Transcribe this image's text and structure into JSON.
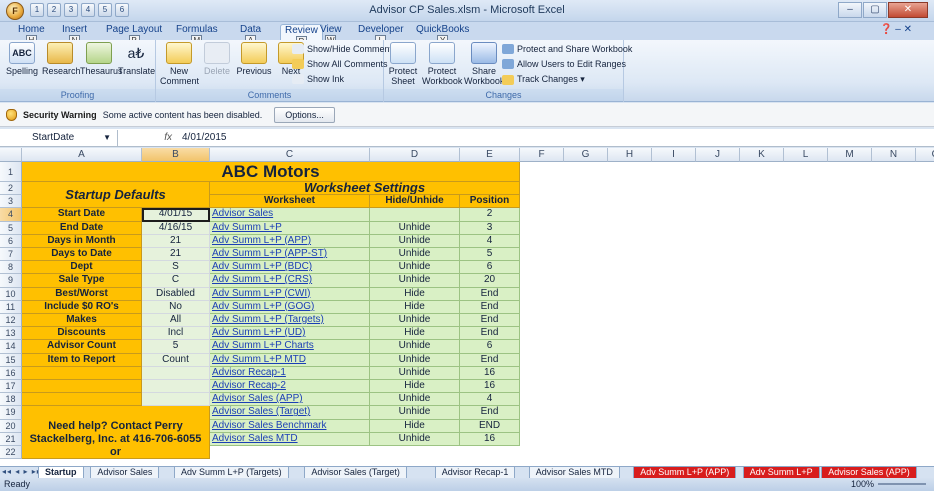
{
  "window": {
    "title": "Advisor CP Sales.xlsm - Microsoft Excel",
    "office_button": "F",
    "qat": [
      "1",
      "2",
      "3",
      "4",
      "5",
      "6"
    ],
    "controls": [
      "–",
      "▢",
      "✕"
    ]
  },
  "tabs": [
    {
      "label": "Home",
      "key": "H"
    },
    {
      "label": "Insert",
      "key": "N"
    },
    {
      "label": "Page Layout",
      "key": "P"
    },
    {
      "label": "Formulas",
      "key": "M"
    },
    {
      "label": "Data",
      "key": "A"
    },
    {
      "label": "Review",
      "key": "R"
    },
    {
      "label": "View",
      "key": "W"
    },
    {
      "label": "Developer",
      "key": "L"
    },
    {
      "label": "QuickBooks",
      "key": "Y"
    }
  ],
  "ribbon": {
    "proofing": {
      "label": "Proofing",
      "buttons": [
        "Spelling",
        "Research",
        "Thesaurus",
        "Translate"
      ]
    },
    "comments": {
      "label": "Comments",
      "new": "New Comment",
      "delete": "Delete",
      "previous": "Previous",
      "next": "Next",
      "show_hide": "Show/Hide Comment",
      "show_all": "Show All Comments",
      "show_ink": "Show Ink"
    },
    "changes": {
      "label": "Changes",
      "protect_sheet": "Protect Sheet",
      "protect_workbook": "Protect Workbook",
      "share_workbook": "Share Workbook",
      "protect_share": "Protect and Share Workbook",
      "allow_users": "Allow Users to Edit Ranges",
      "track_changes": "Track Changes ▾"
    }
  },
  "security": {
    "title": "Security Warning",
    "message": "Some active content has been disabled.",
    "options": "Options..."
  },
  "formula_bar": {
    "name_box": "StartDate",
    "fx": "fx",
    "value": "4/01/2015"
  },
  "columns": [
    "A",
    "B",
    "C",
    "D",
    "E",
    "F",
    "G",
    "H",
    "I",
    "J",
    "K",
    "L",
    "M",
    "N",
    "O"
  ],
  "sheet": {
    "title": "ABC Motors",
    "startup_header": "Startup Defaults",
    "worksheet_header": "Worksheet Settings",
    "col_headers": [
      "Worksheet",
      "Hide/Unhide",
      "Position"
    ],
    "defaults": [
      [
        "Start Date",
        "4/01/15"
      ],
      [
        "End Date",
        "4/16/15"
      ],
      [
        "Days in Month",
        "21"
      ],
      [
        "Days to Date",
        "21"
      ],
      [
        "Dept",
        "S"
      ],
      [
        "Sale Type",
        "C"
      ],
      [
        "Best/Worst",
        "Disabled"
      ],
      [
        "Include $0 RO's",
        "No"
      ],
      [
        "Makes",
        "All"
      ],
      [
        "Discounts",
        "Incl"
      ],
      [
        "Advisor Count",
        "5"
      ],
      [
        "Item to Report",
        "Count"
      ]
    ],
    "help_text": "Need help? Contact Perry Stackelberg, Inc. at 416-706-6055 or",
    "worksheets": [
      [
        "Advisor Sales",
        "",
        "2"
      ],
      [
        "Adv Summ L+P",
        "Unhide",
        "3"
      ],
      [
        "Adv Summ L+P (APP)",
        "Unhide",
        "4"
      ],
      [
        "Adv Summ L+P (APP-ST)",
        "Unhide",
        "5"
      ],
      [
        "Adv Summ L+P (BDC)",
        "Unhide",
        "6"
      ],
      [
        "Adv Summ L+P (CRS)",
        "Unhide",
        "20"
      ],
      [
        "Adv Summ L+P (CWI)",
        "Hide",
        "End"
      ],
      [
        "Adv Summ L+P (GOG)",
        "Hide",
        "End"
      ],
      [
        "Adv Summ L+P (Targets)",
        "Unhide",
        "End"
      ],
      [
        "Adv Summ L+P (UD)",
        "Hide",
        "End"
      ],
      [
        "Adv Summ L+P Charts",
        "Unhide",
        "6"
      ],
      [
        "Adv Summ L+P MTD",
        "Unhide",
        "End"
      ],
      [
        "Advisor Recap-1",
        "Unhide",
        "16"
      ],
      [
        "Advisor Recap-2",
        "Hide",
        "16"
      ],
      [
        "Advisor Sales (APP)",
        "Unhide",
        "4"
      ],
      [
        "Advisor Sales (Target)",
        "Unhide",
        "End"
      ],
      [
        "Advisor Sales Benchmark",
        "Hide",
        "END"
      ],
      [
        "Advisor Sales MTD",
        "Unhide",
        "16"
      ]
    ]
  },
  "sheet_tabs": [
    {
      "label": "Startup",
      "active": true,
      "red": false
    },
    {
      "label": "Advisor Sales",
      "active": false,
      "red": false
    },
    {
      "label": "Adv Summ L+P (Targets)",
      "active": false,
      "red": false
    },
    {
      "label": "Advisor Sales (Target)",
      "active": false,
      "red": false
    },
    {
      "label": "Advisor Recap-1",
      "active": false,
      "red": false
    },
    {
      "label": "Advisor Sales MTD",
      "active": false,
      "red": false
    },
    {
      "label": "Adv Summ L+P (APP)",
      "active": false,
      "red": true
    },
    {
      "label": "Adv Summ L+P",
      "active": false,
      "red": true
    },
    {
      "label": "Advisor Sales (APP)",
      "active": false,
      "red": true
    }
  ],
  "status": {
    "ready": "Ready",
    "zoom": "100%"
  }
}
